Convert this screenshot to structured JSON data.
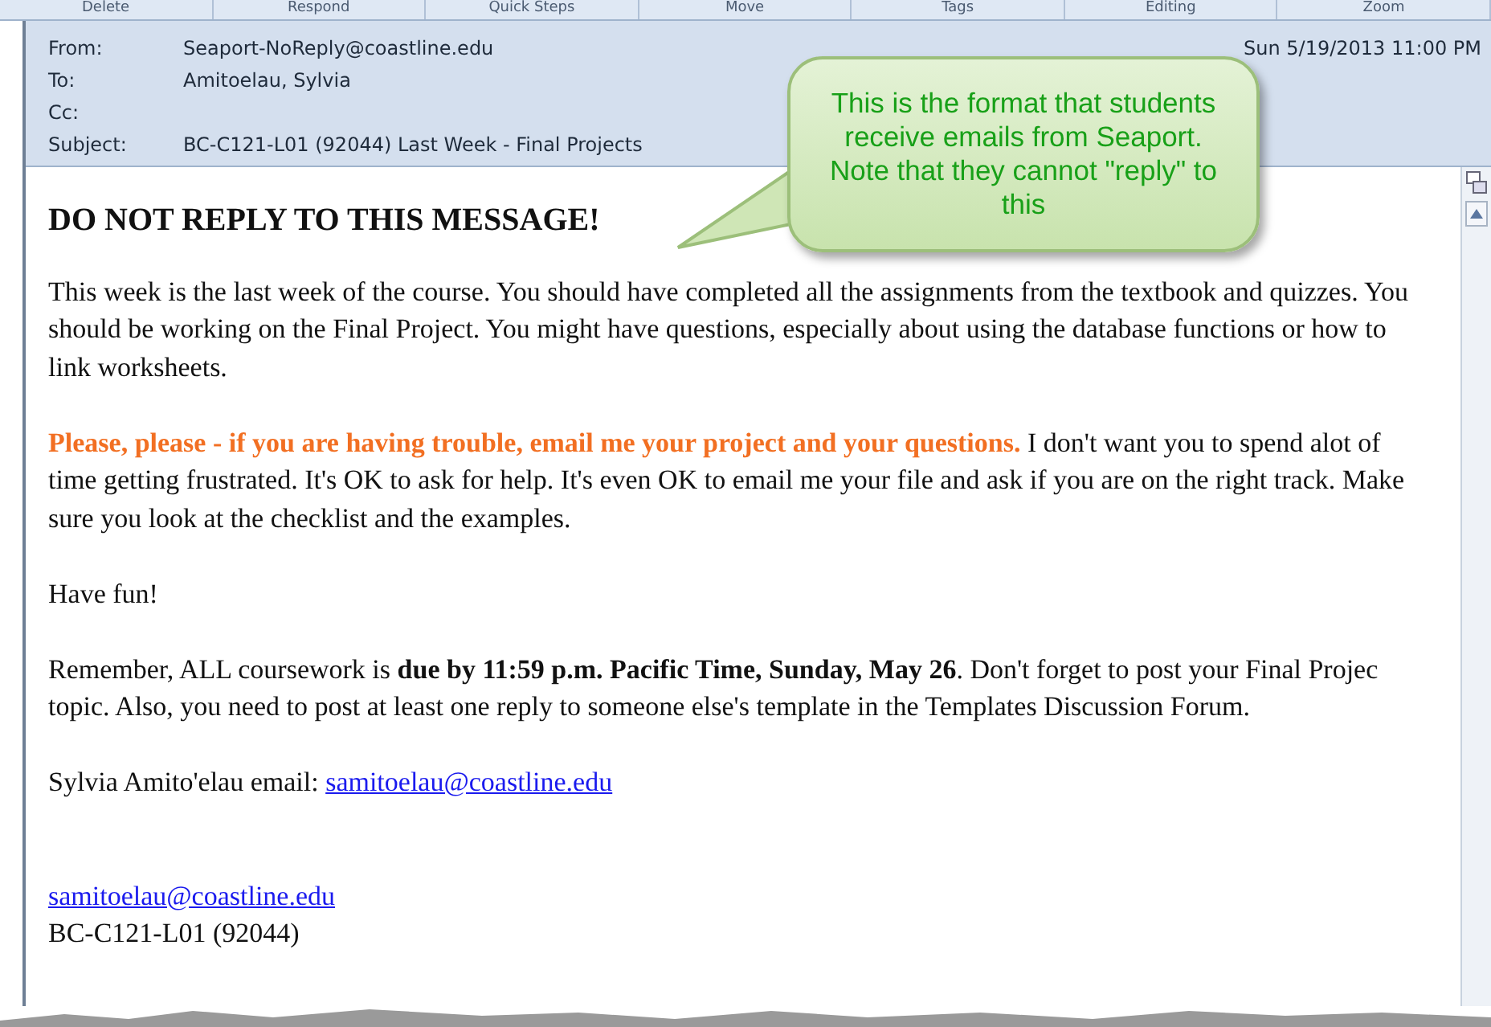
{
  "ribbon_groups": [
    "Delete",
    "Respond",
    "Quick Steps",
    "Move",
    "Tags",
    "Editing",
    "Zoom"
  ],
  "header": [
    {
      "label": "From:",
      "value": "Seaport-NoReply@coastline.edu"
    },
    {
      "label": "To:",
      "value": "Amitoelau, Sylvia"
    },
    {
      "label": "Cc:"
    },
    {
      "label": "Subject:",
      "value": "BC-C121-L01 (92044) Last Week - Final Projects"
    }
  ],
  "sent_value": "Sun 5/19/2013 11:00 PM",
  "callout": "This is the format that students receive emails from Seaport. Note that they cannot \"reply\" to this",
  "body": {
    "heading": "DO NOT REPLY TO THIS MESSAGE!",
    "paragraphs": [
      {
        "kind": "plain",
        "text": "This week is the last week of the course. You should have completed all the assignments from the textbook and quizzes.  You should be working on the Final Project.  You might have questions, especially about using the database functions or how to link worksheets."
      },
      {
        "kind": "alert",
        "alert": "Please, please - if you are having trouble, email me your project and your questions.",
        "text": "I don't want you to spend alot of time getting frustrated.  It's OK to ask for help.  It's even OK to email me your file and ask if you are on the right track.  Make sure you look at the checklist and the examples."
      },
      {
        "kind": "plain",
        "text": "Have fun!"
      },
      {
        "kind": "plain",
        "text": "Remember, ALL coursework is **due by 11:59 p.m. Pacific Time, Sunday, May 26**. Don't forget to post your Final Projec topic. Also, you need to post at least one reply to someone else's template in the Templates Discussion Forum."
      }
    ],
    "signature": {
      "text": "Sylvia Amito'elau  email:",
      "link": "samitoelau@coastline.edu"
    },
    "footer_link": "samitoelau@coastline.edu",
    "footer_text": "BC-C121-L01 (92044)"
  }
}
